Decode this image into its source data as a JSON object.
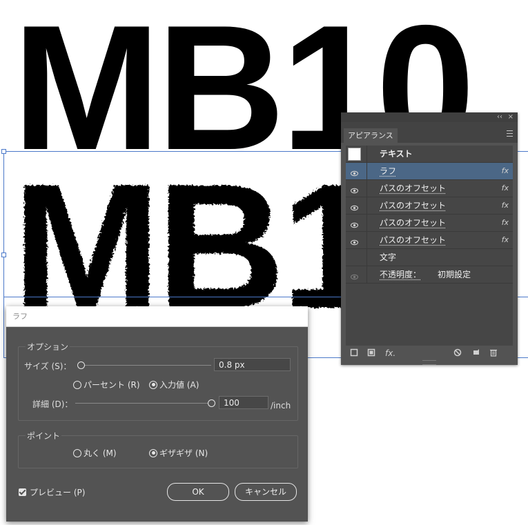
{
  "artwork": {
    "text_top": "MB10",
    "text_rough": "MB10"
  },
  "appearance_panel": {
    "collapse_glyph": "‹‹",
    "close_glyph": "×",
    "tab_label": "アピアランス",
    "rows": [
      {
        "label": "テキスト",
        "kind": "header",
        "has_swatch": true,
        "swatch_color": "#ffffff"
      },
      {
        "label": "ラフ",
        "fx": "fx",
        "selected": true,
        "eye": true
      },
      {
        "label": "パスのオフセット",
        "fx": "fx",
        "eye": true
      },
      {
        "label": "パスのオフセット",
        "fx": "fx",
        "eye": true
      },
      {
        "label": "パスのオフセット",
        "fx": "fx",
        "eye": true
      },
      {
        "label": "パスのオフセット",
        "fx": "fx",
        "eye": true
      },
      {
        "label": "文字",
        "eye": false
      },
      {
        "label": "不透明度：",
        "value": "初期設定",
        "eye": true,
        "eye_dim": true
      }
    ],
    "footer_icons": [
      "new-stroke-icon",
      "new-fill-icon",
      "fx-menu-icon",
      "clear-appearance-icon",
      "duplicate-item-icon",
      "trash-icon"
    ],
    "fx_footer_label": "fx."
  },
  "rough_dialog": {
    "title": "ラフ",
    "options_group": "オプション",
    "size_label": "サイズ (S)：",
    "size_value": "0.8 px",
    "size_slider_fraction": 0.0,
    "relative_label": "パーセント (R)",
    "absolute_label": "入力値 (A)",
    "absolute_selected": true,
    "detail_label": "詳細 (D)：",
    "detail_value": "100",
    "detail_unit": "/inch",
    "detail_slider_fraction": 1.0,
    "points_group": "ポイント",
    "smooth_label": "丸く (M)",
    "corner_label": "ギザギザ (N)",
    "corner_selected": true,
    "preview_label": "プレビュー (P)",
    "preview_checked": true,
    "ok_label": "OK",
    "cancel_label": "キャンセル"
  },
  "colors": {
    "panel_bg": "#535353",
    "selected_row": "#4b6786",
    "selection_blue": "#4a78c9"
  }
}
